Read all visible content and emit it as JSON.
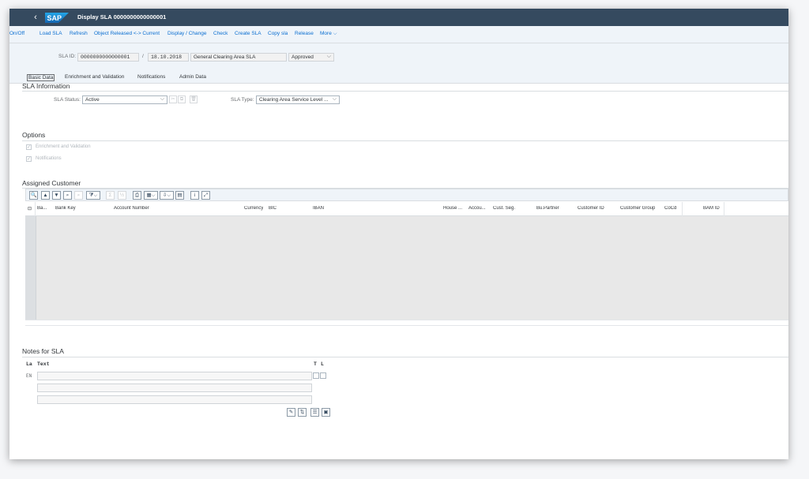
{
  "shell": {
    "back_icon": "‹",
    "logo_text": "SAP",
    "title": "Display SLA 0000000000000001"
  },
  "toolbar": {
    "items": [
      "On/Off",
      "Load SLA",
      "Refresh",
      "Object Released <-> Current",
      "Display / Change",
      "Check",
      "Create SLA",
      "Copy sla",
      "Release",
      "More"
    ]
  },
  "header": {
    "sla_id_label": "SLA ID:",
    "sla_id": "0000000000000001",
    "separator": "/",
    "date": "18.10.2018",
    "description": "General Clearing Area SLA",
    "status": "Approved",
    "tabs": [
      "Basic Data",
      "Enrichment and Validation",
      "Notifications",
      "Admin Data"
    ],
    "active_tab": "Basic Data"
  },
  "sla_info": {
    "title": "SLA Information",
    "status_label": "SLA Status:",
    "status_value": "Active",
    "type_label": "SLA Type:",
    "type_value": "Clearing Area Service Level ..."
  },
  "options": {
    "title": "Options",
    "items": [
      {
        "label": "Enrichment and Validation",
        "checked": true
      },
      {
        "label": "Notifications",
        "checked": true
      }
    ]
  },
  "assigned_customer": {
    "title": "Assigned Customer",
    "columns": [
      "Ba...",
      "Bank Key",
      "Account Number",
      "Currency",
      "BIC",
      "IBAN",
      "House ...",
      "Accou...",
      "Cust. Seg.",
      "Bu.Partner",
      "Customer ID",
      "Customer Group",
      "CoCd",
      "BAM ID"
    ],
    "rows": []
  },
  "notes": {
    "title": "Notes for SLA",
    "col_lang": "La",
    "col_text": "Text",
    "col_t": "T",
    "col_l": "L",
    "row_lang": "EN"
  },
  "colors": {
    "shell": "#354a5f",
    "toolbar_bg": "#eff4f9",
    "link": "#0a6ed1",
    "sap_logo": "#1b8fd6"
  }
}
